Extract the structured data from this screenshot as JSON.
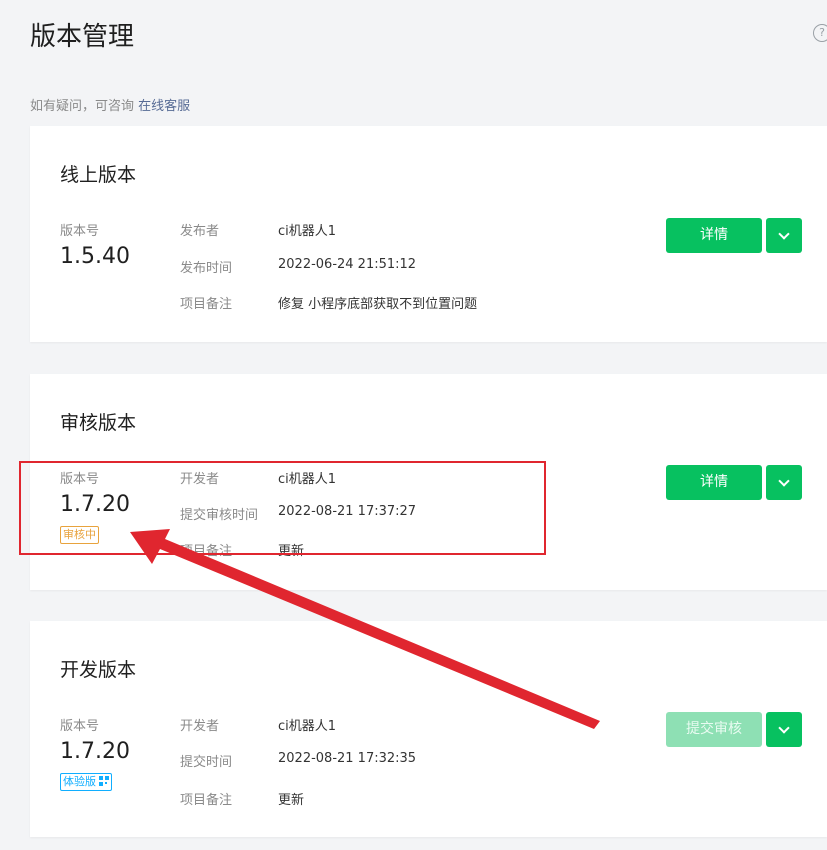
{
  "page": {
    "title": "版本管理",
    "consult_text": "如有疑问，可咨询",
    "consult_link": "在线客服"
  },
  "online": {
    "title": "线上版本",
    "version_label": "版本号",
    "version": "1.5.40",
    "publisher_label": "发布者",
    "publisher": "ci机器人1",
    "time_label": "发布时间",
    "time": "2022-06-24 21:51:12",
    "note_label": "项目备注",
    "note": "修复 小程序底部获取不到位置问题",
    "detail_button": "详情"
  },
  "review": {
    "title": "审核版本",
    "version_label": "版本号",
    "version": "1.7.20",
    "status_tag": "审核中",
    "developer_label": "开发者",
    "developer": "ci机器人1",
    "time_label": "提交审核时间",
    "time": "2022-08-21 17:37:27",
    "note_label": "项目备注",
    "note": "更新",
    "detail_button": "详情"
  },
  "dev": {
    "title": "开发版本",
    "version_label": "版本号",
    "version": "1.7.20",
    "trial_tag": "体验版",
    "developer_label": "开发者",
    "developer": "ci机器人1",
    "time_label": "提交时间",
    "time": "2022-08-21 17:32:35",
    "note_label": "项目备注",
    "note": "更新",
    "submit_button": "提交审核"
  },
  "icons": {
    "help": "help-icon",
    "dropdown": "chevron-down-icon",
    "qrcode": "qrcode-icon"
  },
  "colors": {
    "primary": "#07c160",
    "review_tag": "#e8a33d",
    "trial_tag": "#10aeff",
    "annotation": "#e0262f",
    "link": "#576b95"
  }
}
